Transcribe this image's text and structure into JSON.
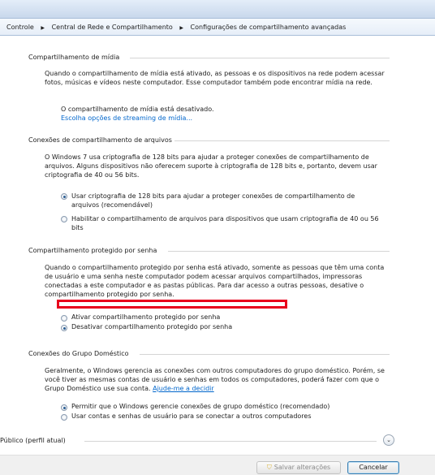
{
  "breadcrumb": {
    "items": [
      "Controle",
      "Central de Rede e Compartilhamento",
      "Configurações de compartilhamento avançadas"
    ],
    "separator": "▶"
  },
  "media": {
    "header": "Compartilhamento de mídia",
    "description": "Quando o compartilhamento de mídia está ativado, as pessoas e os dispositivos na rede podem acessar fotos, músicas e vídeos neste computador. Esse computador também pode encontrar mídia na rede.",
    "status": "O compartilhamento de mídia está desativado.",
    "link": "Escolha opções de streaming de mídia..."
  },
  "file_connections": {
    "header": "Conexões de compartilhamento de arquivos",
    "description": "O Windows 7 usa criptografia de 128 bits para ajudar a proteger conexões de compartilhamento de arquivos. Alguns dispositivos não oferecem suporte à criptografia de 128 bits e, portanto, devem usar criptografia de 40 ou 56 bits.",
    "options": [
      {
        "label": "Usar criptografia de 128 bits para ajudar a proteger conexões de compartilhamento de arquivos (recomendável)",
        "selected": true
      },
      {
        "label": "Habilitar o compartilhamento de arquivos para dispositivos que usam criptografia de 40 ou 56 bits",
        "selected": false
      }
    ]
  },
  "password": {
    "header": "Compartilhamento protegido por senha",
    "description": "Quando o compartilhamento protegido por senha está ativado, somente as pessoas que têm uma conta de usuário e uma senha neste computador podem acessar arquivos compartilhados, impressoras conectadas a este computador e as pastas públicas. Para dar acesso a outras pessoas, desative o compartilhamento protegido por senha.",
    "options": [
      {
        "label": "Ativar compartilhamento protegido por senha",
        "selected": false
      },
      {
        "label": "Desativar compartilhamento protegido por senha",
        "selected": true
      }
    ],
    "highlight_color": "#e8001c"
  },
  "homegroup": {
    "header": "Conexões do Grupo Doméstico",
    "description": "Geralmente, o Windows gerencia as conexões com outros computadores do grupo doméstico. Porém, se você tiver as mesmas contas de usuário e senhas em todos os computadores, poderá fazer com que o Grupo Doméstico use sua conta.",
    "help_link": "Ajude-me a decidir",
    "options": [
      {
        "label": "Permitir que o Windows gerencie conexões de grupo doméstico (recomendado)",
        "selected": true
      },
      {
        "label": "Usar contas e senhas de usuário para se conectar a outros computadores",
        "selected": false
      }
    ]
  },
  "public_profile": {
    "label": "Público (perfil atual)",
    "expander_icon": "chevron-down-icon"
  },
  "buttons": {
    "save": "Salvar alterações",
    "cancel": "Cancelar"
  },
  "icons": {
    "breadcrumb_separator": "triangle-right-icon",
    "save_shield": "shield-icon"
  }
}
